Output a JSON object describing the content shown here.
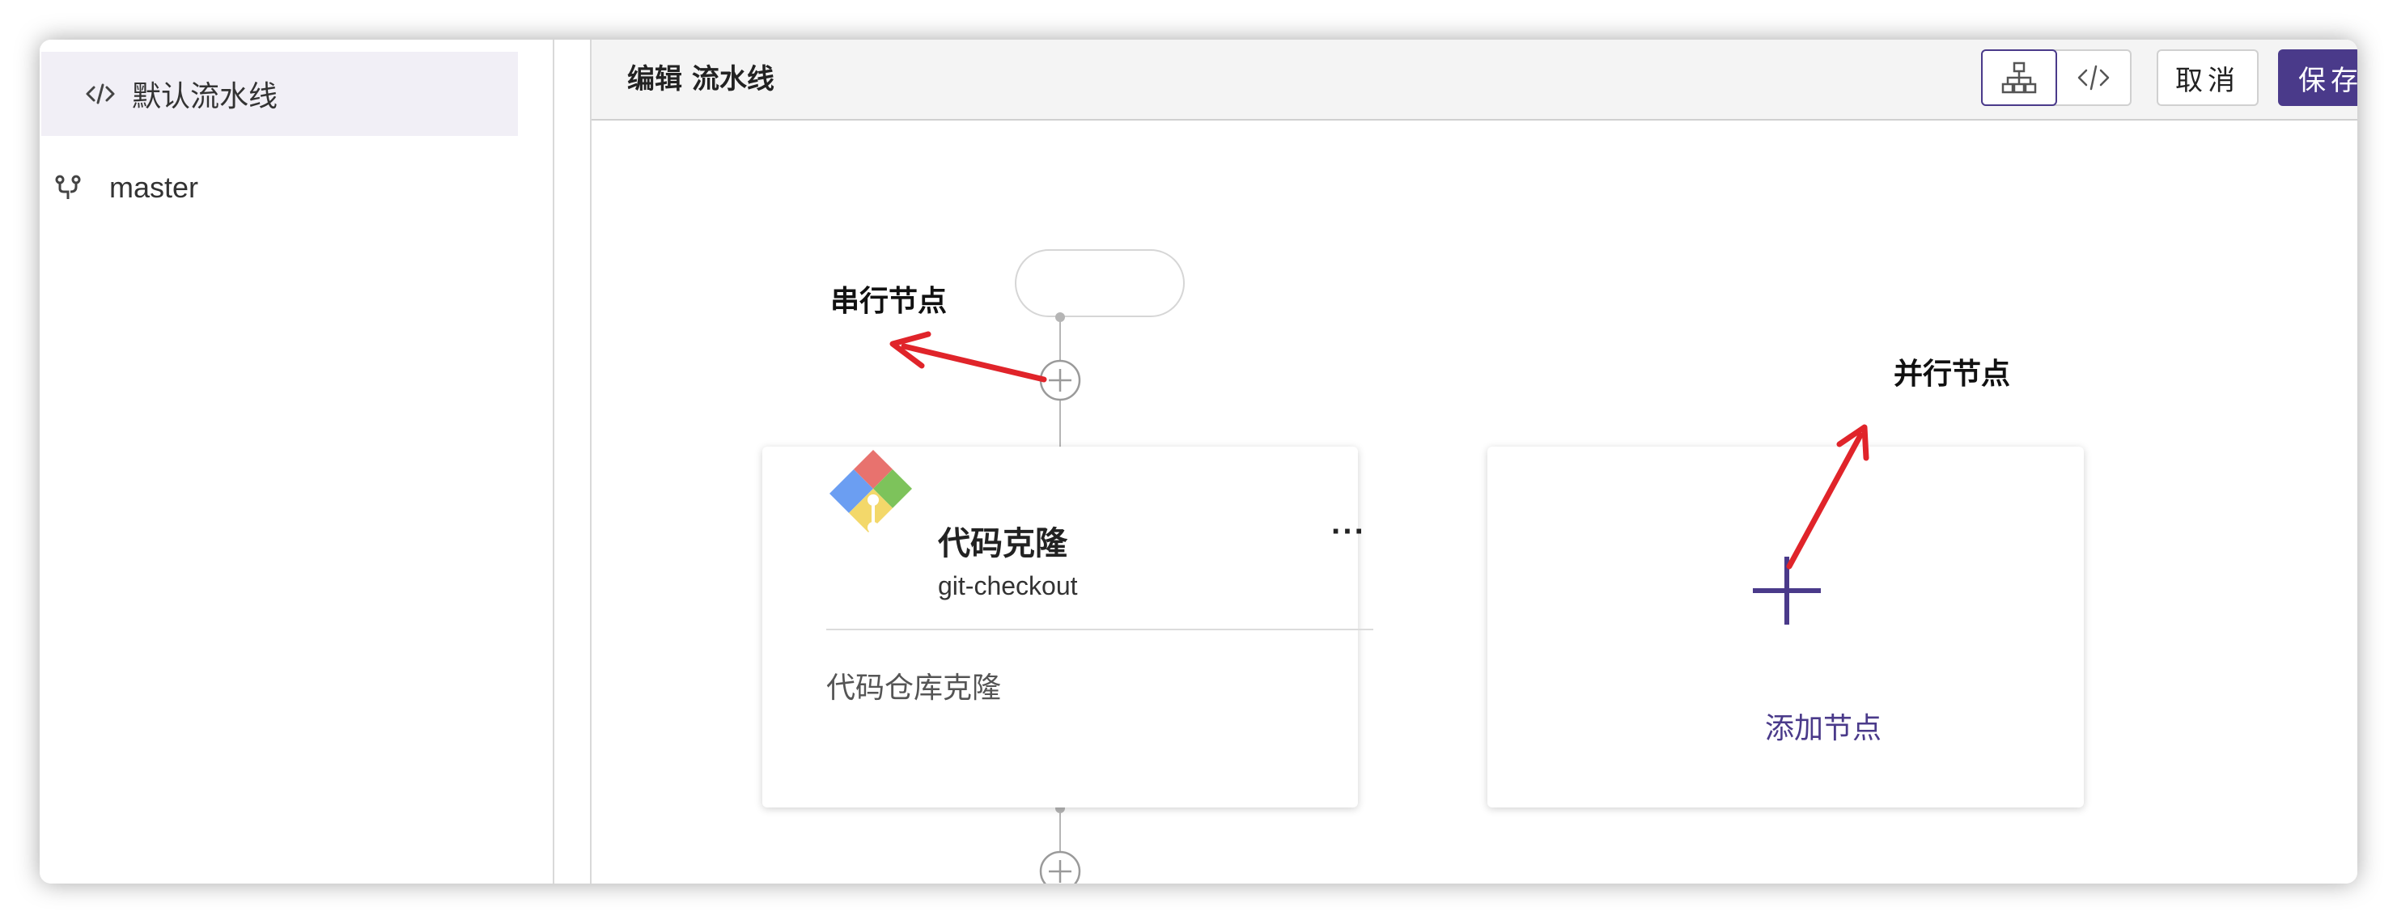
{
  "sidebar": {
    "pipeline_label": "默认流水线",
    "branch_label": "master"
  },
  "header": {
    "title": "编辑 流水线",
    "cancel_label": "取消",
    "save_label": "保存"
  },
  "canvas": {
    "card": {
      "title": "代码克隆",
      "subtitle": "git-checkout",
      "description": "代码仓库克隆",
      "more_label": "···"
    },
    "add_node_label": "添加节点",
    "annotations": {
      "serial": "串行节点",
      "parallel": "并行节点"
    }
  },
  "colors": {
    "accent": "#4a3a8a",
    "arrow": "#e0242a"
  }
}
